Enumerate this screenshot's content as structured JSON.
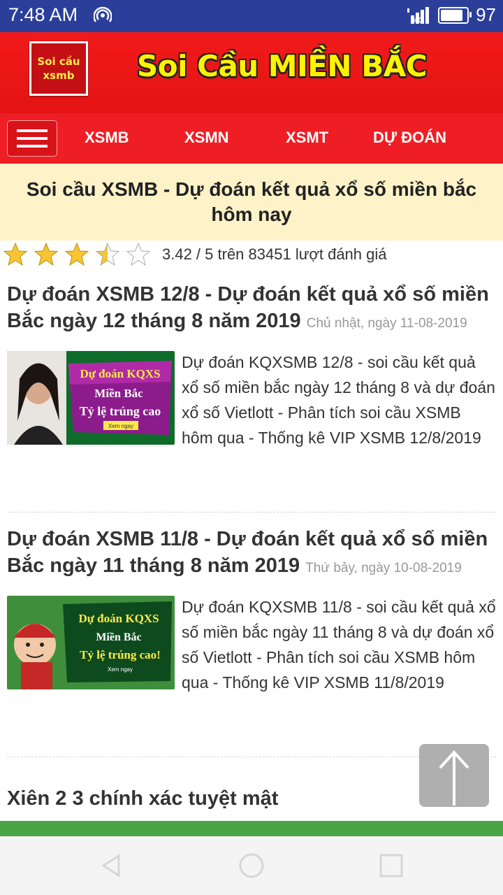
{
  "status_bar": {
    "time": "7:48 AM",
    "network": "4G",
    "battery": "97",
    "battery_level": 0.97
  },
  "banner": {
    "logo_line1": "Soi cầu",
    "logo_line2": "xsmb",
    "title": "Soi Cầu MIỀN BẮC"
  },
  "nav": {
    "items": [
      "XSMB",
      "XSMN",
      "XSMT",
      "DỰ ĐOÁN"
    ]
  },
  "headline": "Soi cầu XSMB - Dự đoán kết quả xổ số miền bắc hôm nay",
  "rating": {
    "score": 3.42,
    "max": 5,
    "text": "3.42 / 5 trên 83451 lượt đánh giá"
  },
  "articles": [
    {
      "title": "Dự đoán XSMB 12/8 - Dự đoán kết quả xổ số miền Bắc ngày 12 tháng 8 năm 2019",
      "date": "Chủ nhật, ngày 11-08-2019",
      "thumb_lines": [
        "Dự đoán KQXS",
        "Miền Bắc",
        "Tỷ lệ trúng cao",
        "Xem ngay"
      ],
      "excerpt": "Dự đoán KQXSMB 12/8 - soi cầu kết quả xổ số miền bắc ngày 12 tháng 8 và dự đoán xổ số Vietlott - Phân tích soi cầu XSMB hôm qua - Thống kê VIP XSMB 12/8/2019"
    },
    {
      "title": "Dự đoán XSMB 11/8 - Dự đoán kết quả xổ số miền Bắc ngày 11 tháng 8 năm 2019",
      "date": "Thứ bảy, ngày 10-08-2019",
      "thumb_lines": [
        "Dự đoán KQXS",
        "Miền Bắc",
        "Tỷ lệ trúng cao!",
        "Xem ngay"
      ],
      "excerpt": "Dự đoán KQXSMB 11/8 - soi cầu kết quả xổ số miền bắc ngày 11 tháng 8 và dự đoán xổ số Vietlott - Phân tích soi cầu XSMB hôm qua - Thống kê VIP XSMB 11/8/2019"
    }
  ],
  "section_title": "Xiên 2 3 chính xác tuyệt mật",
  "icons": {
    "hotspot": "hotspot-icon",
    "signal": "signal-icon",
    "battery": "battery-icon",
    "menu": "hamburger-menu-icon",
    "scroll_top": "arrow-up-icon",
    "back": "back-triangle-icon",
    "home": "home-circle-icon",
    "recents": "recents-square-icon"
  },
  "colors": {
    "status_bar": "#2a3e9a",
    "banner": "#e31414",
    "nav": "#ef1e24",
    "banner_title": "#fff200",
    "headline_bg": "#fdf2c8",
    "star": "#f7c531",
    "green_bar": "#4aa544"
  }
}
